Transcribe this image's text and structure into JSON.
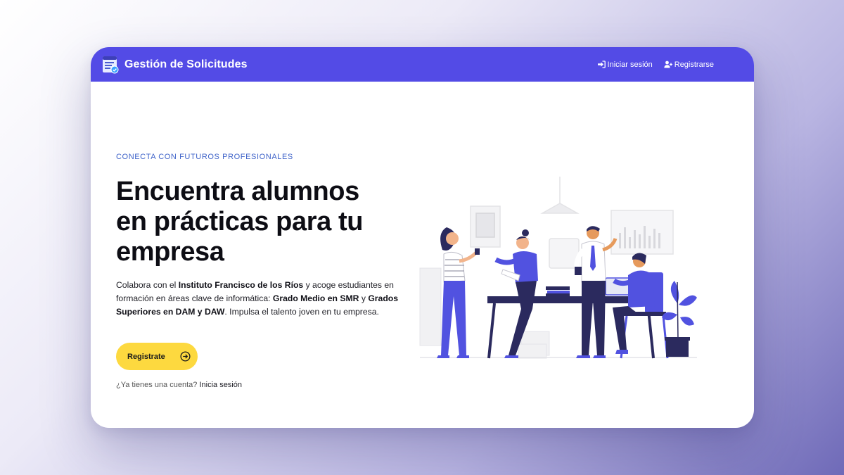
{
  "navbar": {
    "brand_title": "Gestión de Solicitudes",
    "login_label": "Iniciar sesión",
    "register_label": "Registrarse"
  },
  "hero": {
    "eyebrow": "CONECTA CON FUTUROS PROFESIONALES",
    "headline_lines": [
      "Encuentra alumnos",
      "en prácticas para tu",
      "empresa"
    ],
    "description": {
      "part1": "Colabora con el ",
      "bold1": "Instituto Francisco de los Ríos",
      "part2": " y acoge estudiantes en formación en áreas clave de informática: ",
      "bold2": "Grado Medio en SMR",
      "part3": " y ",
      "bold3": "Grados Superiores en DAM y DAW",
      "part4": ". Impulsa el talento joven en tu empresa."
    },
    "cta_label": "Registrate",
    "login_prompt": "¿Ya tienes una cuenta?",
    "login_link": "Inicia sesión"
  },
  "icons": {
    "brand": "document-check-icon",
    "login": "sign-in-icon",
    "register": "user-plus-icon",
    "cta": "arrow-right-circle-icon"
  },
  "colors": {
    "navbar": "#534be6",
    "accent": "#fdd93f",
    "eyebrow": "#3f63c9",
    "illustration_primary": "#5152e0",
    "illustration_dark": "#2b2a5e"
  }
}
